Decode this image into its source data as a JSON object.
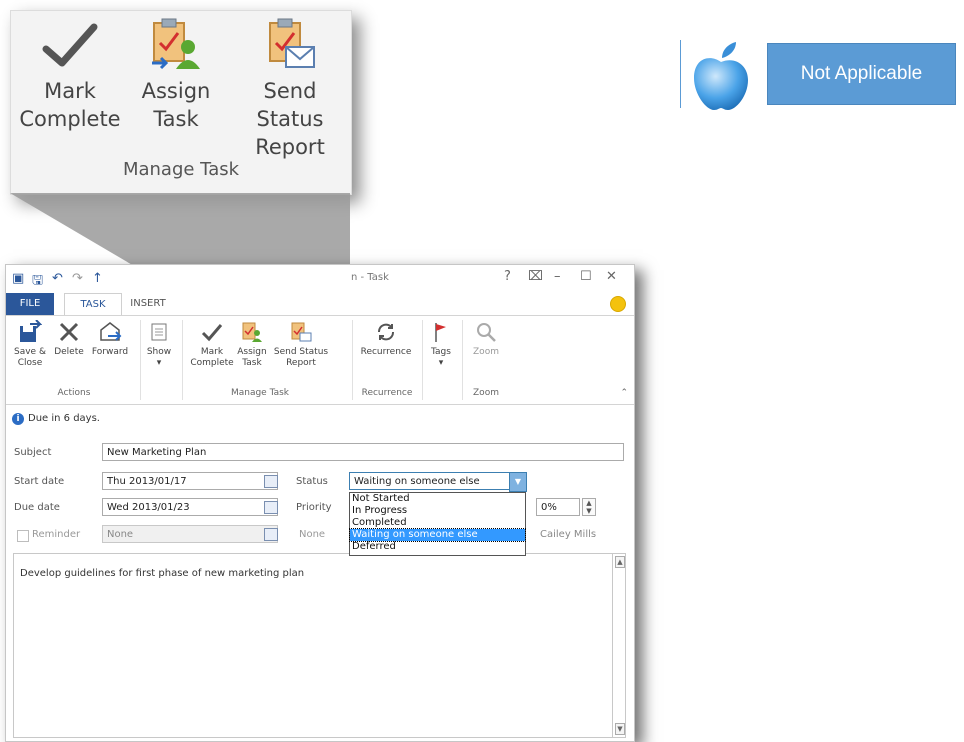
{
  "zoom": {
    "buttons": [
      {
        "label": "Mark\nComplete"
      },
      {
        "label": "Assign\nTask"
      },
      {
        "label": "Send Status\nReport"
      }
    ],
    "group_label": "Manage Task"
  },
  "mac_badge": {
    "label": "Not Applicable"
  },
  "window": {
    "title": "n - Task",
    "controls": [
      "?",
      "⌧",
      "–",
      "☐",
      "✕"
    ],
    "tabs": [
      "FILE",
      "TASK",
      "INSERT"
    ],
    "ribbon": {
      "actions": [
        {
          "label": "Save &\nClose"
        },
        {
          "label": "Delete"
        },
        {
          "label": "Forward"
        }
      ],
      "show_label": "Show\n▾",
      "manage": [
        {
          "label": "Mark\nComplete"
        },
        {
          "label": "Assign\nTask"
        },
        {
          "label": "Send Status\nReport"
        }
      ],
      "recurrence_label": "Recurrence",
      "tags_label": "Tags\n▾",
      "zoom_label": "Zoom",
      "groups": [
        "Actions",
        "Manage Task",
        "Recurrence",
        "Zoom"
      ],
      "collapse": "⌃"
    },
    "info": "Due in 6 days.",
    "form": {
      "subject_label": "Subject",
      "subject_value": "New Marketing Plan",
      "start_label": "Start date",
      "start_value": "Thu 2013/01/17",
      "due_label": "Due date",
      "due_value": "Wed 2013/01/23",
      "reminder_label": "Reminder",
      "reminder_value": "None",
      "status_label": "Status",
      "status_value": "Waiting on someone else",
      "status_options": [
        "Not Started",
        "In Progress",
        "Completed",
        "Waiting on someone else",
        "Deferred"
      ],
      "priority_label": "Priority",
      "priority_value": "None",
      "percent_value": "0%",
      "owner": "Cailey Mills"
    },
    "notes": "Develop guidelines for first phase of new marketing plan"
  }
}
